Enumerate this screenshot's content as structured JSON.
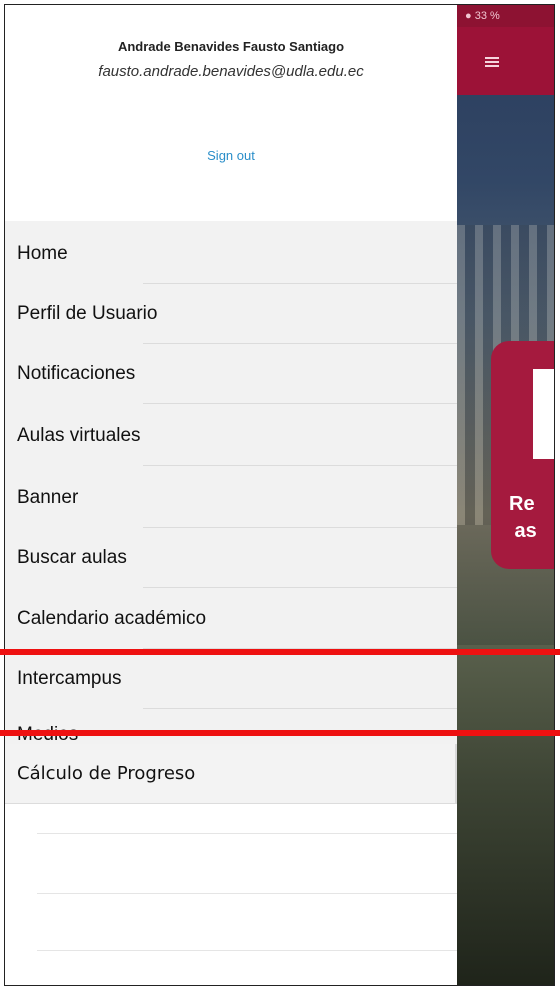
{
  "app": {
    "status_text": "● 33 %",
    "promo_text": "Re\n as"
  },
  "drawer": {
    "user_name": "Andrade Benavides Fausto Santiago",
    "user_email": "fausto.andrade.benavides@udla.edu.ec",
    "sign_out_label": "Sign out",
    "menu_items": [
      {
        "label": "Home"
      },
      {
        "label": "Perfil de Usuario"
      },
      {
        "label": "Notificaciones"
      },
      {
        "label": "Aulas virtuales"
      },
      {
        "label": "Banner"
      },
      {
        "label": "Buscar aulas"
      },
      {
        "label": "Calendario académico"
      },
      {
        "label": "Intercampus"
      },
      {
        "label": "Medios"
      },
      {
        "label": "Cálculo de Progreso"
      }
    ]
  },
  "colors": {
    "brand": "#9c1237",
    "link": "#2a8ec9",
    "highlight_line": "#ee1111"
  }
}
